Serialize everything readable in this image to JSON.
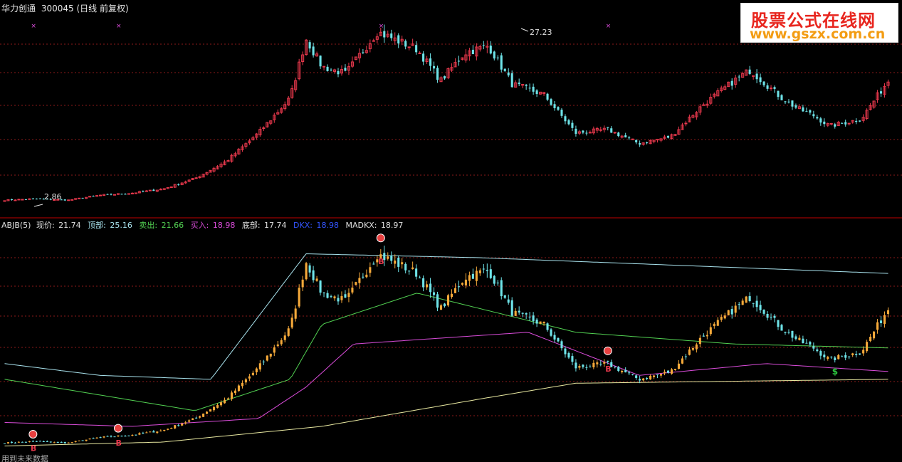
{
  "header": {
    "stock_name": "华力创通",
    "stock_code": "300045",
    "period_label": "(日线 前复权)"
  },
  "price_panel": {
    "high_label": "27.23",
    "low_label": "2.86",
    "ylim": [
      0,
      30
    ]
  },
  "indicator_panel": {
    "name": "ABJB(5)",
    "readouts": [
      {
        "label": "现价:",
        "value": "21.74",
        "color": "#e0e0e0"
      },
      {
        "label": "顶部:",
        "value": "25.16",
        "color": "#a9e3ee"
      },
      {
        "label": "卖出:",
        "value": "21.66",
        "color": "#52d152"
      },
      {
        "label": "买入:",
        "value": "18.98",
        "color": "#d94cd9"
      },
      {
        "label": "底部:",
        "value": "17.74",
        "color": "#e0e0e0"
      },
      {
        "label": "DKX:",
        "value": "18.98",
        "color": "#3355ff"
      },
      {
        "label": "MADKX:",
        "value": "18.97",
        "color": "#e0e0e0"
      }
    ]
  },
  "footer": {
    "text": "用到未来数据"
  },
  "watermark": {
    "title": "股票公式在线网",
    "url": "www.gszx.com.cn"
  },
  "colors": {
    "background": "#000000",
    "up": "#e8384c",
    "down": "#6ee3e8",
    "gridline": "#8b1a1a",
    "divider": "#c00000",
    "signal_candle": "#f5a93a",
    "top_band": "#a9e3ee",
    "sell_line": "#52d152",
    "buy_line": "#d94cd9",
    "bottom_line": "#e8e8a0",
    "signal_b": "#e8384c",
    "signal_s": "#2ecc40"
  },
  "chart_data": {
    "type": "candlestick",
    "bars": 250,
    "price_path": [
      [
        0,
        2.9
      ],
      [
        20,
        3.1
      ],
      [
        40,
        2.9
      ],
      [
        60,
        3.6
      ],
      [
        80,
        3.9
      ],
      [
        100,
        4.5
      ],
      [
        120,
        6.0
      ],
      [
        140,
        8.5
      ],
      [
        160,
        12.5
      ],
      [
        180,
        17.5
      ],
      [
        190,
        26.0
      ],
      [
        200,
        22.0
      ],
      [
        215,
        21.0
      ],
      [
        235,
        27.0
      ],
      [
        260,
        24.5
      ],
      [
        275,
        20.0
      ],
      [
        290,
        24.0
      ],
      [
        305,
        25.0
      ],
      [
        320,
        19.5
      ],
      [
        340,
        18.0
      ],
      [
        360,
        12.5
      ],
      [
        380,
        13.0
      ],
      [
        400,
        11.0
      ],
      [
        420,
        12.0
      ],
      [
        440,
        16.5
      ],
      [
        460,
        20.0
      ],
      [
        470,
        21.5
      ],
      [
        490,
        17.5
      ],
      [
        500,
        16.0
      ],
      [
        510,
        15.0
      ],
      [
        520,
        13.5
      ],
      [
        540,
        14.5
      ],
      [
        557,
        20.0
      ]
    ],
    "top_band_path": [
      [
        0,
        13.0
      ],
      [
        60,
        11.5
      ],
      [
        130,
        11.0
      ],
      [
        190,
        27.0
      ],
      [
        300,
        26.5
      ],
      [
        557,
        24.5
      ]
    ],
    "sell_path": [
      [
        0,
        11.0
      ],
      [
        60,
        9.0
      ],
      [
        120,
        7.0
      ],
      [
        180,
        11.0
      ],
      [
        200,
        18.0
      ],
      [
        260,
        22.0
      ],
      [
        360,
        17.0
      ],
      [
        460,
        15.5
      ],
      [
        557,
        15.0
      ]
    ],
    "buy_path": [
      [
        0,
        5.5
      ],
      [
        80,
        5.0
      ],
      [
        160,
        6.0
      ],
      [
        190,
        10.0
      ],
      [
        220,
        15.5
      ],
      [
        330,
        17.0
      ],
      [
        400,
        11.5
      ],
      [
        480,
        13.0
      ],
      [
        557,
        12.0
      ]
    ],
    "bottom_path": [
      [
        0,
        2.5
      ],
      [
        100,
        3.0
      ],
      [
        200,
        5.0
      ],
      [
        300,
        8.5
      ],
      [
        360,
        10.5
      ],
      [
        557,
        11.0
      ]
    ]
  }
}
